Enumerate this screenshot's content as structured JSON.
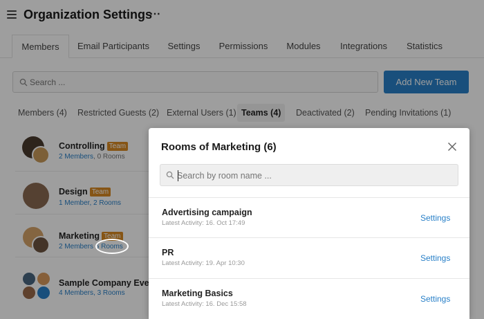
{
  "header": {
    "title": "Organization Settings",
    "more_icon": "more-horizontal-icon"
  },
  "tabs": [
    {
      "label": "Members",
      "active": true
    },
    {
      "label": "Email Participants"
    },
    {
      "label": "Settings"
    },
    {
      "label": "Permissions"
    },
    {
      "label": "Modules"
    },
    {
      "label": "Integrations"
    },
    {
      "label": "Statistics"
    }
  ],
  "search": {
    "placeholder": "Search ..."
  },
  "add_team_label": "Add New Team",
  "subtabs": [
    {
      "label": "Members (4)"
    },
    {
      "label": "Restricted Guests (2)"
    },
    {
      "label": "External Users (1)"
    },
    {
      "label": "Teams (4)",
      "active": true
    },
    {
      "label": "Deactivated (2)"
    },
    {
      "label": "Pending Invitations (1)"
    }
  ],
  "teams": [
    {
      "name": "Controlling",
      "badge": "Team",
      "members": "2 Members",
      "rooms": "0 Rooms"
    },
    {
      "name": "Design",
      "badge": "Team",
      "members": "1 Member",
      "rooms": "2 Rooms"
    },
    {
      "name": "Marketing",
      "badge": "Team",
      "members": "2 Members",
      "rooms": "6 Rooms"
    },
    {
      "name": "Sample Company Every",
      "badge": "",
      "members": "4 Members",
      "rooms": "3 Rooms"
    }
  ],
  "modal": {
    "title": "Rooms of Marketing (6)",
    "search_placeholder": "Search by room name ...",
    "rooms": [
      {
        "name": "Advertising campaign",
        "activity": "Latest Activity: 16. Oct 17:49",
        "settings": "Settings"
      },
      {
        "name": "PR",
        "activity": "Latest Activity: 19. Apr 10:30",
        "settings": "Settings"
      },
      {
        "name": "Marketing Basics",
        "activity": "Latest Activity: 16. Dec 15:58",
        "settings": "Settings"
      }
    ]
  },
  "colors": {
    "accent": "#2980c8",
    "badge": "#d98a22",
    "overlay": "rgba(0,0,0,0.38)"
  }
}
